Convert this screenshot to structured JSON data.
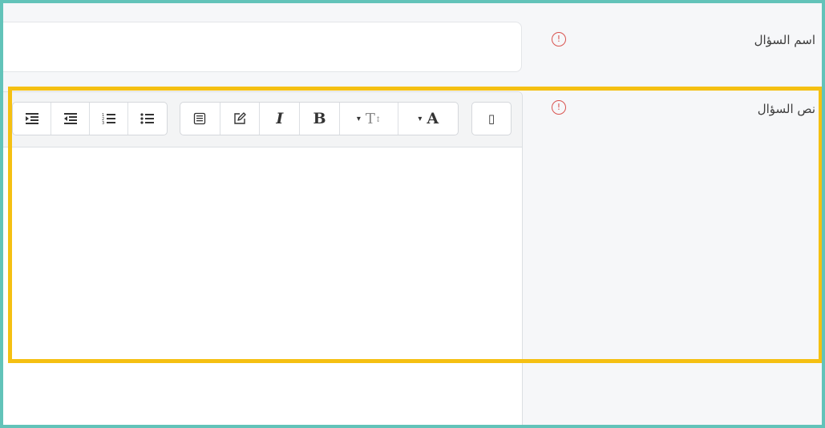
{
  "form": {
    "name_label": "اسم السؤال",
    "text_label": "نص السؤال",
    "required_symbol": "!",
    "name_value": ""
  },
  "toolbar": {
    "group_lists": [
      "indent-icon",
      "outdent-icon",
      "ordered-list-icon",
      "unordered-list-icon"
    ],
    "group_format": [
      "template-icon",
      "edit-icon",
      "italic-icon",
      "bold-icon",
      "font-size-icon",
      "font-color-icon"
    ],
    "italic_glyph": "I",
    "bold_glyph": "B",
    "font_color_glyph": "A",
    "font_size_glyph": "T",
    "dropdown_caret": "▾",
    "html_glyph": "▯"
  },
  "colors": {
    "frame": "#62c3b9",
    "highlight": "#f5c012",
    "required": "#d9534f"
  }
}
